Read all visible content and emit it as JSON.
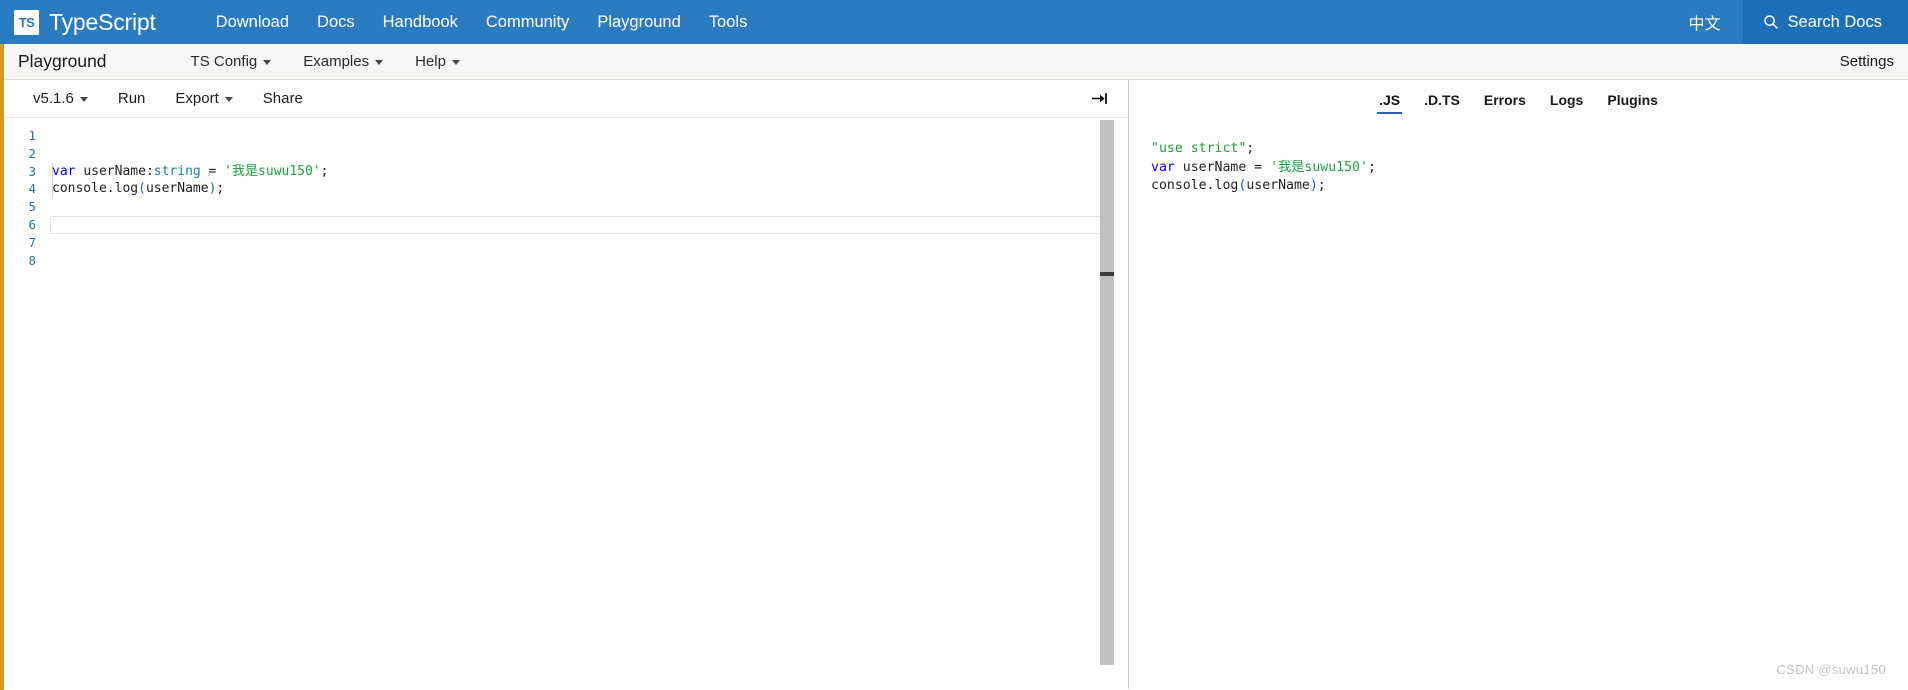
{
  "colors": {
    "nav_blue": "#2b7bc0",
    "nav_blue_dark": "#1d6fb8",
    "gold_stripe": "#cf9a30",
    "line_number": "#237893",
    "keyword": "#0000ff",
    "type": "#267f99",
    "string": "#1f9f3f",
    "function": "#2a5db0",
    "tab_underline": "#2a5db0"
  },
  "topnav": {
    "logo_text": "TS",
    "brand": "TypeScript",
    "links": [
      {
        "label": "Download",
        "name": "nav-link-download"
      },
      {
        "label": "Docs",
        "name": "nav-link-docs"
      },
      {
        "label": "Handbook",
        "name": "nav-link-handbook"
      },
      {
        "label": "Community",
        "name": "nav-link-community"
      },
      {
        "label": "Playground",
        "name": "nav-link-playground"
      },
      {
        "label": "Tools",
        "name": "nav-link-tools"
      }
    ],
    "language_label": "中文",
    "search_label": "Search Docs",
    "search_icon": "search-icon"
  },
  "subheader": {
    "title": "Playground",
    "menu": [
      {
        "label": "TS Config",
        "caret": true
      },
      {
        "label": "Examples",
        "caret": true
      },
      {
        "label": "Help",
        "caret": true
      }
    ],
    "settings_label": "Settings"
  },
  "editor_toolbar": {
    "version_label": "v5.1.6",
    "run_label": "Run",
    "export_label": "Export",
    "share_label": "Share",
    "collapse_icon": "collapse-sidebar-icon",
    "collapse_glyph": "→|"
  },
  "editor": {
    "line_numbers": [
      "1",
      "2",
      "3",
      "4",
      "5",
      "6",
      "7",
      "8"
    ],
    "current_line": 6,
    "code": {
      "line3": {
        "kw": "var",
        "space1": " ",
        "ident": "userName",
        "colon": ":",
        "type": "string",
        "eq": " = ",
        "str": "'我是suwu150'",
        "semi": ";"
      },
      "line4": {
        "obj": "console",
        "dot": ".",
        "fn": "log",
        "open": "(",
        "arg": "userName",
        "close": ")",
        "semi": ";"
      }
    }
  },
  "output": {
    "tabs": [
      {
        "label": ".JS",
        "active": true
      },
      {
        "label": ".D.TS",
        "active": false
      },
      {
        "label": "Errors",
        "active": false
      },
      {
        "label": "Logs",
        "active": false
      },
      {
        "label": "Plugins",
        "active": false
      }
    ],
    "code": {
      "line1": {
        "str": "\"use strict\"",
        "semi": ";"
      },
      "line2": {
        "kw": "var",
        "mid": " userName = ",
        "str": "'我是suwu150'",
        "semi": ";"
      },
      "line3": {
        "obj": "console",
        "dot": ".",
        "fn": "log",
        "open": "(",
        "arg": "userName",
        "close": ")",
        "semi": ";"
      }
    }
  },
  "watermark": "CSDN @suwu150"
}
